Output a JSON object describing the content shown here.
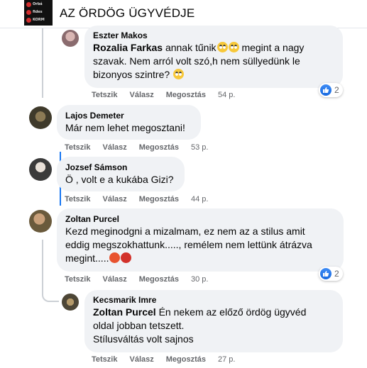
{
  "header": {
    "title": "AZ ÖRDÖG ÜGYVÉDJE",
    "thumb_lines": [
      "Orbá",
      "fides",
      "KORM"
    ]
  },
  "actions_labels": {
    "like": "Tetszik",
    "reply": "Válasz",
    "share": "Megosztás"
  },
  "comments": [
    {
      "author": "Eszter Makos",
      "mention": "Rozalia Farkas",
      "text_line1": " annak tűnik",
      "text_line1_after": " megint a nagy",
      "text_line2": "szavak. Nem arról volt szó,h nem süllyedünk le",
      "text_line3": "bizonyos szintre? ",
      "time": "54 p.",
      "reactions": "2",
      "emojis": [
        "face-with-rolling-eyes-icon",
        "face-with-rolling-eyes-icon",
        "face-with-rolling-eyes-icon"
      ]
    },
    {
      "author": "Lajos Demeter",
      "text": "Már nem lehet megosztani!",
      "time": "53 p."
    },
    {
      "author": "Jozsef Sámson",
      "text": "Ö , volt e a kukába Gizi?",
      "time": "44 p."
    },
    {
      "author": "Zoltan Purcel",
      "text_line1": "Kezd meginodgni a mizalmam, ez nem az a stilus amit",
      "text_line2": "eddig megszokhattunk....., remélem nem lettünk átrázva",
      "text_line3": "megint.....",
      "time": "30 p.",
      "reactions": "2",
      "emojis": [
        "angry-face-icon",
        "face-with-symbols-icon"
      ]
    },
    {
      "author": "Kecsmarik Imre",
      "mention": "Zoltan Purcel",
      "text_line1": " Én nekem az előző ördög ügyvéd",
      "text_line2": "oldal jobban tetszett.",
      "text_line3": "Stílusváltás volt sajnos",
      "time": "27 p."
    }
  ],
  "colors": {
    "bubble": "#f0f2f5",
    "meta": "#65676b",
    "like": "#1877f2",
    "thread": "#ccd0d5"
  }
}
